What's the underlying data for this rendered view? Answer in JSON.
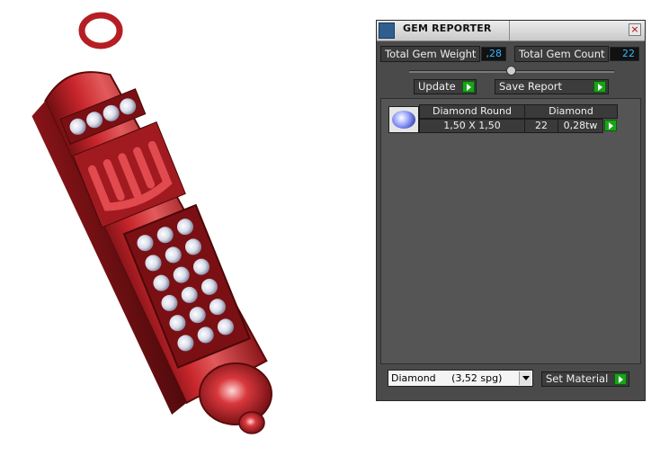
{
  "panel": {
    "title": "GEM REPORTER",
    "close_label": "×",
    "total_weight_label": "Total Gem Weight",
    "total_weight_value": ",28",
    "total_count_label": "Total Gem Count",
    "total_count_value": "22",
    "update_label": "Update",
    "save_label": "Save Report"
  },
  "gem_rows": [
    {
      "shape": "Diamond Round",
      "size": "1,50 X 1,50",
      "material": "Diamond",
      "count": "22",
      "weight": "0,28tw"
    }
  ],
  "footer": {
    "material_select": "Diamond     (3,52 spg)",
    "set_material_label": "Set Material"
  },
  "colors": {
    "accent_value": "#37b7ff",
    "arrow_green": "#18a418",
    "model_red": "#c8262c"
  },
  "icons": [
    "gem-reporter-icon",
    "close-icon",
    "slider-knob",
    "play-arrow-icon",
    "diamond-round-thumbnail",
    "chevron-down-icon"
  ]
}
